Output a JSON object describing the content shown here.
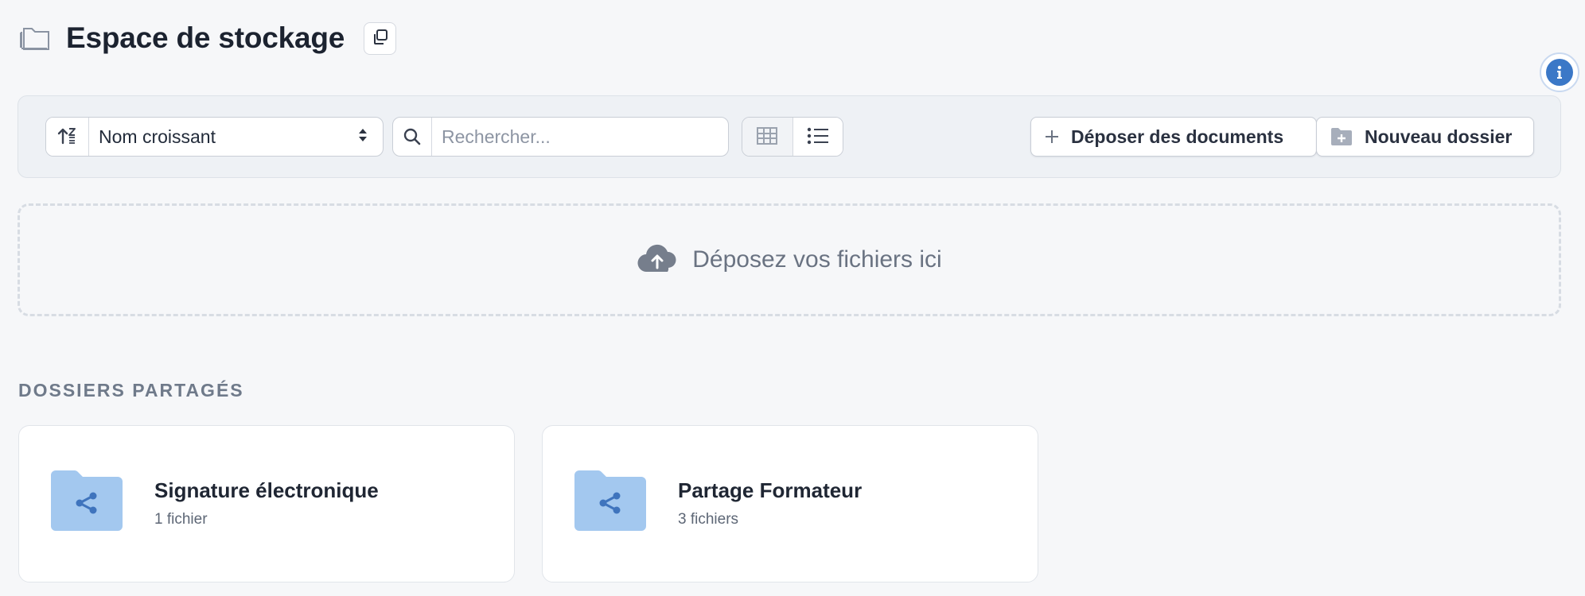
{
  "header": {
    "title": "Espace de stockage",
    "icons": {
      "title": "folder-outline-icon",
      "copy": "copy-icon",
      "info": "info-icon"
    }
  },
  "toolbar": {
    "sort": {
      "selected": "Nom croissant",
      "order_icon": "sort-ascending-icon",
      "chevron_icon": "select-arrows-icon"
    },
    "search": {
      "placeholder": "Rechercher...",
      "value": "",
      "icon": "search-icon"
    },
    "view": {
      "grid_icon": "grid-icon",
      "list_icon": "list-icon",
      "active": "list"
    },
    "upload_label": "Déposer des documents",
    "new_folder_label": "Nouveau dossier"
  },
  "dropzone": {
    "text": "Déposez vos fichiers ici",
    "icon": "cloud-upload-icon"
  },
  "shared": {
    "heading": "DOSSIERS PARTAGÉS",
    "folders": [
      {
        "name": "Signature électronique",
        "meta": "1 fichier",
        "icon": "shared-folder-icon"
      },
      {
        "name": "Partage Formateur",
        "meta": "3 fichiers",
        "icon": "shared-folder-icon"
      }
    ]
  },
  "colors": {
    "background": "#f6f7f9",
    "accent": "#3b78c7",
    "folder": "#a3c8ef",
    "folder_share": "#3f74bd"
  }
}
